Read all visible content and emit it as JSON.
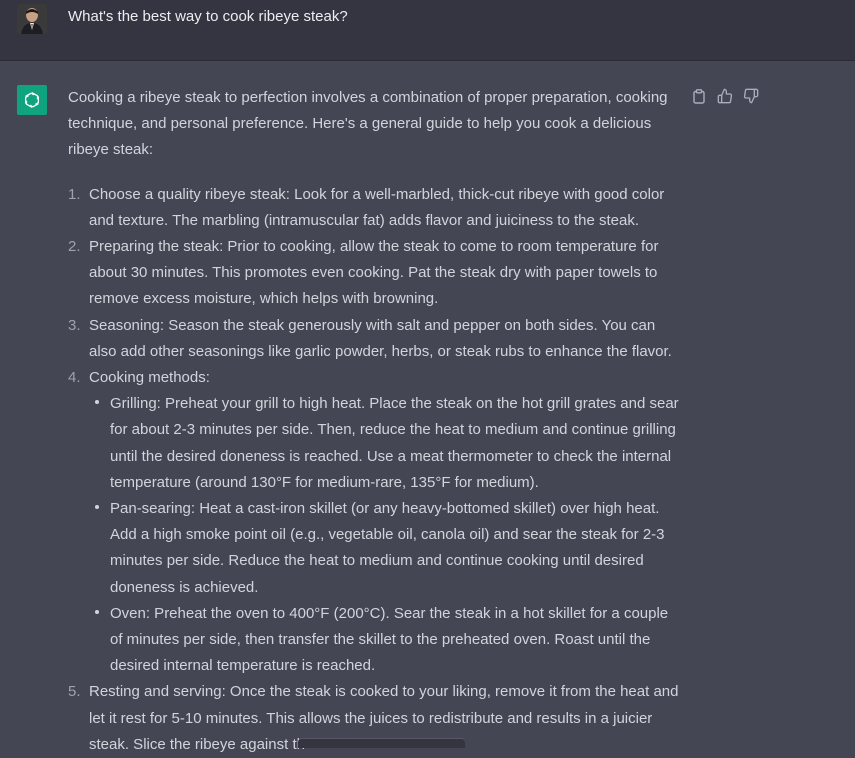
{
  "user": {
    "avatar": "user-avatar",
    "message": "What's the best way to cook ribeye steak?"
  },
  "assistant": {
    "avatar": "openai-logo-icon",
    "intro": "Cooking a ribeye steak to perfection involves a combination of proper preparation, cooking technique, and personal preference. Here's a general guide to help you cook a delicious ribeye steak:",
    "steps": [
      {
        "num": "1.",
        "text": "Choose a quality ribeye steak: Look for a well-marbled, thick-cut ribeye with good color and texture. The marbling (intramuscular fat) adds flavor and juiciness to the steak."
      },
      {
        "num": "2.",
        "text": "Preparing the steak: Prior to cooking, allow the steak to come to room temperature for about 30 minutes. This promotes even cooking. Pat the steak dry with paper towels to remove excess moisture, which helps with browning."
      },
      {
        "num": "3.",
        "text": "Seasoning: Season the steak generously with salt and pepper on both sides. You can also add other seasonings like garlic powder, herbs, or steak rubs to enhance the flavor."
      },
      {
        "num": "4.",
        "text": "Cooking methods:"
      },
      {
        "num": "5.",
        "text": "Resting and serving: Once the steak is cooked to your liking, remove it from the heat and let it rest for 5-10 minutes. This allows the juices to redistribute and results in a juicier steak. Slice the ribeye against th"
      }
    ],
    "methods": [
      "Grilling: Preheat your grill to high heat. Place the steak on the hot grill grates and sear for about 2-3 minutes per side. Then, reduce the heat to medium and continue grilling until the desired doneness is reached. Use a meat thermometer to check the internal temperature (around 130°F for medium-rare, 135°F for medium).",
      "Pan-searing: Heat a cast-iron skillet (or any heavy-bottomed skillet) over high heat. Add a high smoke point oil (e.g., vegetable oil, canola oil) and sear the steak for 2-3 minutes per side. Reduce the heat to medium and continue cooking until desired doneness is achieved.",
      "Oven: Preheat the oven to 400°F (200°C). Sear the steak in a hot skillet for a couple of minutes per side, then transfer the skillet to the preheated oven. Roast until the desired internal temperature is reached."
    ],
    "actions": [
      "copy-icon",
      "thumbs-up-icon",
      "thumbs-down-icon"
    ]
  },
  "colors": {
    "user_bg": "#343541",
    "assistant_bg": "#444654",
    "brand_green": "#10a37f",
    "text": "#d1d5db"
  }
}
